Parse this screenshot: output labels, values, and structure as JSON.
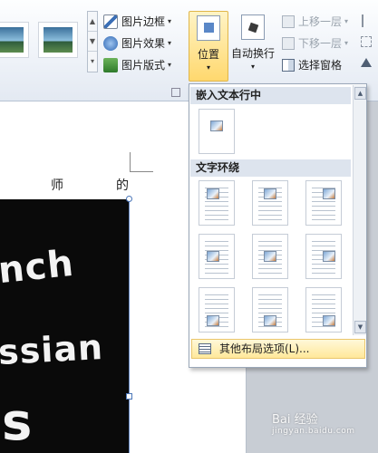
{
  "ribbon": {
    "picture_styles": {
      "border": "图片边框",
      "effects": "图片效果",
      "layout": "图片版式"
    },
    "position_button": "位置",
    "wrap_text_button": "自动换行",
    "arrange": {
      "bring_forward": "上移一层",
      "send_backward": "下移一层",
      "selection_pane": "选择窗格"
    }
  },
  "document": {
    "text_left": "师",
    "text_right": "的",
    "chalk_lines": [
      "nch",
      "ssian",
      "s"
    ]
  },
  "position_menu": {
    "section_inline": "嵌入文本行中",
    "section_wrap": "文字环绕",
    "more_options": "其他布局选项(L)..."
  },
  "watermark": {
    "brand": "Bai 经验",
    "url": "jingyan.baidu.com"
  },
  "colors": {
    "accent_hover": "#ffd86e",
    "section_header": "#dde4ee",
    "selection_handle": "#4a76b8"
  }
}
